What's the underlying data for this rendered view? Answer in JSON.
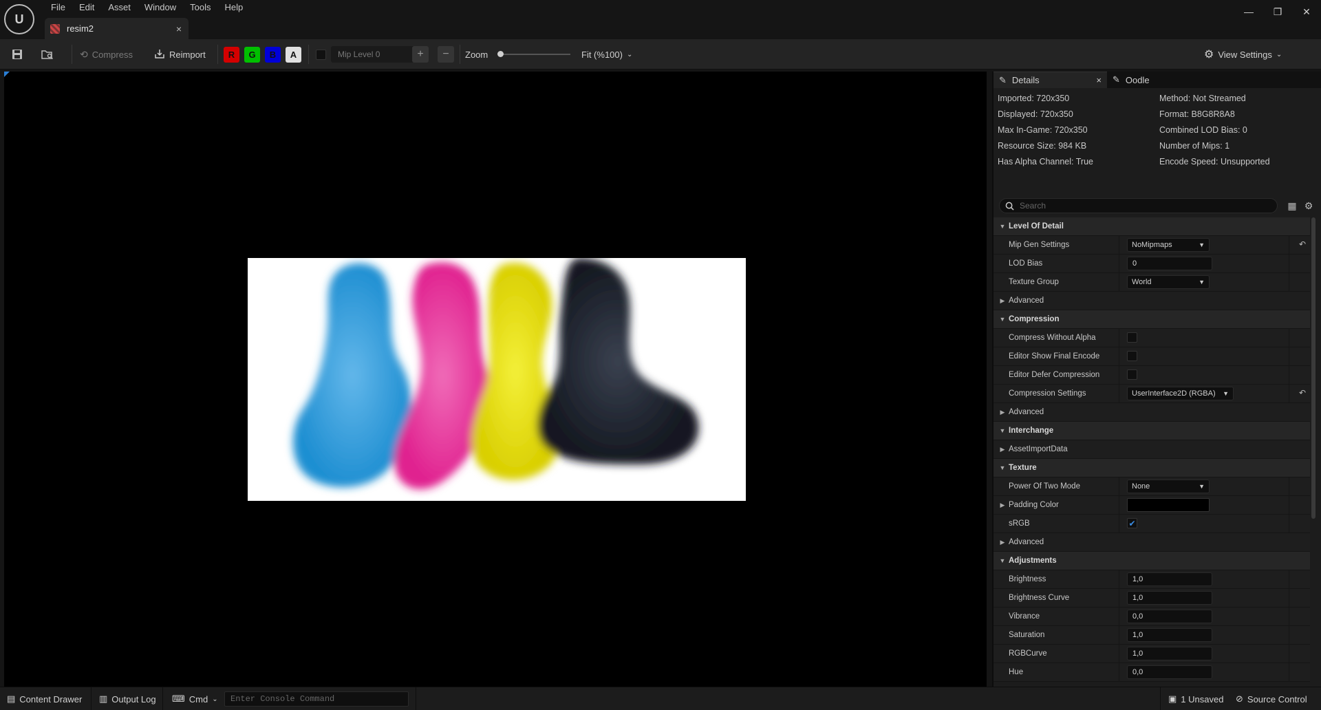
{
  "menu": [
    "File",
    "Edit",
    "Asset",
    "Window",
    "Tools",
    "Help"
  ],
  "document_tab": {
    "label": "resim2",
    "close": "×"
  },
  "window_controls": {
    "minimize": "—",
    "restore": "❐",
    "close": "✕"
  },
  "toolbar": {
    "compress_label": "Compress",
    "reimport_label": "Reimport",
    "channels": [
      {
        "label": "R",
        "color": "#d40000"
      },
      {
        "label": "G",
        "color": "#00c000"
      },
      {
        "label": "B",
        "color": "#0000d8"
      },
      {
        "label": "A",
        "color": "#e0e0e0"
      }
    ],
    "mip_level": "Mip Level 0",
    "zoom_label": "Zoom",
    "zoom_fit": "Fit (%100)",
    "view_settings": "View Settings"
  },
  "details": {
    "tab_details": "Details",
    "tab_oodle": "Oodle",
    "info_left": [
      "Imported: 720x350",
      "Displayed: 720x350",
      "Max In-Game: 720x350",
      "Resource Size: 984 KB",
      "Has Alpha Channel: True"
    ],
    "info_right": [
      "Method: Not Streamed",
      "Format: B8G8R8A8",
      "Combined LOD Bias: 0",
      "Number of Mips: 1",
      "Encode Speed: Unsupported"
    ],
    "search_placeholder": "Search",
    "properties": {
      "lod_category": "Level Of Detail",
      "mip_gen_settings": {
        "label": "Mip Gen Settings",
        "value": "NoMipmaps"
      },
      "lod_bias": {
        "label": "LOD Bias",
        "value": "0"
      },
      "texture_group": {
        "label": "Texture Group",
        "value": "World"
      },
      "advanced1": "Advanced",
      "compression_category": "Compression",
      "compress_without_alpha": "Compress Without Alpha",
      "editor_show_final_encode": "Editor Show Final Encode",
      "editor_defer_compression": "Editor Defer Compression",
      "compression_settings": {
        "label": "Compression Settings",
        "value": "UserInterface2D (RGBA)"
      },
      "advanced2": "Advanced",
      "interchange_category": "Interchange",
      "asset_import_data": "AssetImportData",
      "texture_category": "Texture",
      "power_of_two_mode": {
        "label": "Power Of Two Mode",
        "value": "None"
      },
      "padding_color": "Padding Color",
      "srgb": {
        "label": "sRGB",
        "checked": true
      },
      "advanced3": "Advanced",
      "adjustments_category": "Adjustments",
      "brightness": {
        "label": "Brightness",
        "value": "1,0"
      },
      "brightness_curve": {
        "label": "Brightness Curve",
        "value": "1,0"
      },
      "vibrance": {
        "label": "Vibrance",
        "value": "0,0"
      },
      "saturation": {
        "label": "Saturation",
        "value": "1,0"
      },
      "rgbcurve": {
        "label": "RGBCurve",
        "value": "1,0"
      },
      "hue": {
        "label": "Hue",
        "value": "0,0"
      }
    }
  },
  "statusbar": {
    "content_drawer": "Content Drawer",
    "output_log": "Output Log",
    "cmd": "Cmd",
    "console_placeholder": "Enter Console Command",
    "unsaved": "1 Unsaved",
    "source_control": "Source Control"
  }
}
